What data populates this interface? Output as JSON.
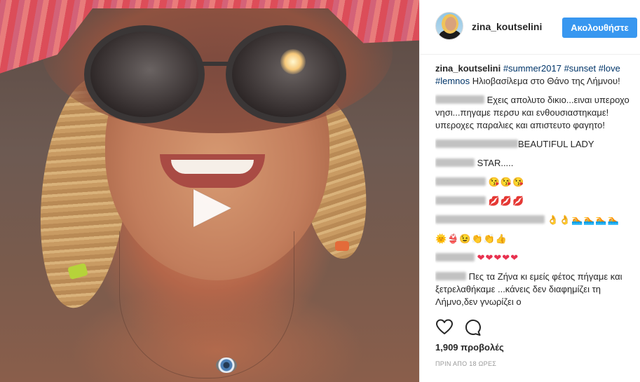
{
  "post": {
    "username": "zina_koutselini",
    "follow_label": "Ακολουθήστε",
    "caption": {
      "username": "zina_koutselini",
      "hashtags": [
        "#summer2017",
        "#sunset",
        "#love",
        "#lemnos"
      ],
      "text": "Ηλιοβασίλεμα στο Θάνο της Λήμνου!"
    },
    "comments": [
      {
        "text": "Εχεις απολυτο δικιο...ειναι υπεροχο νησι...πηγαμε περσυ και ενθουσιαστηκαμε!υπεροχες παραλιες και απιστευτο φαγητο!"
      },
      {
        "text": "BEAUTIFUL LADY"
      },
      {
        "text": "STAR....."
      },
      {
        "text": "😘😘😘"
      },
      {
        "text": "💋💋💋"
      },
      {
        "text": "👌👌🏊🏊🏊🏊"
      },
      {
        "text": "🌞👙😉👏👏👍"
      },
      {
        "text": "❤❤❤❤❤"
      },
      {
        "text": "Πες τα Ζήνα κι εμείς φέτος πήγαμε και ξετρελαθήκαμε ...κάνεις δεν διαφημίζει τη Λήμνο,δεν γνωρίζει ο"
      }
    ],
    "views": "1,909 προβολές",
    "time": "ΠΡΙΝ ΑΠΟ 18 ΩΡΕΣ",
    "icons": {
      "play": "play-icon",
      "like": "heart-icon",
      "comment": "comment-icon"
    },
    "colors": {
      "follow_button": "#3897f0",
      "hashtag": "#003569",
      "heart_emoji": "#e8314f"
    }
  }
}
